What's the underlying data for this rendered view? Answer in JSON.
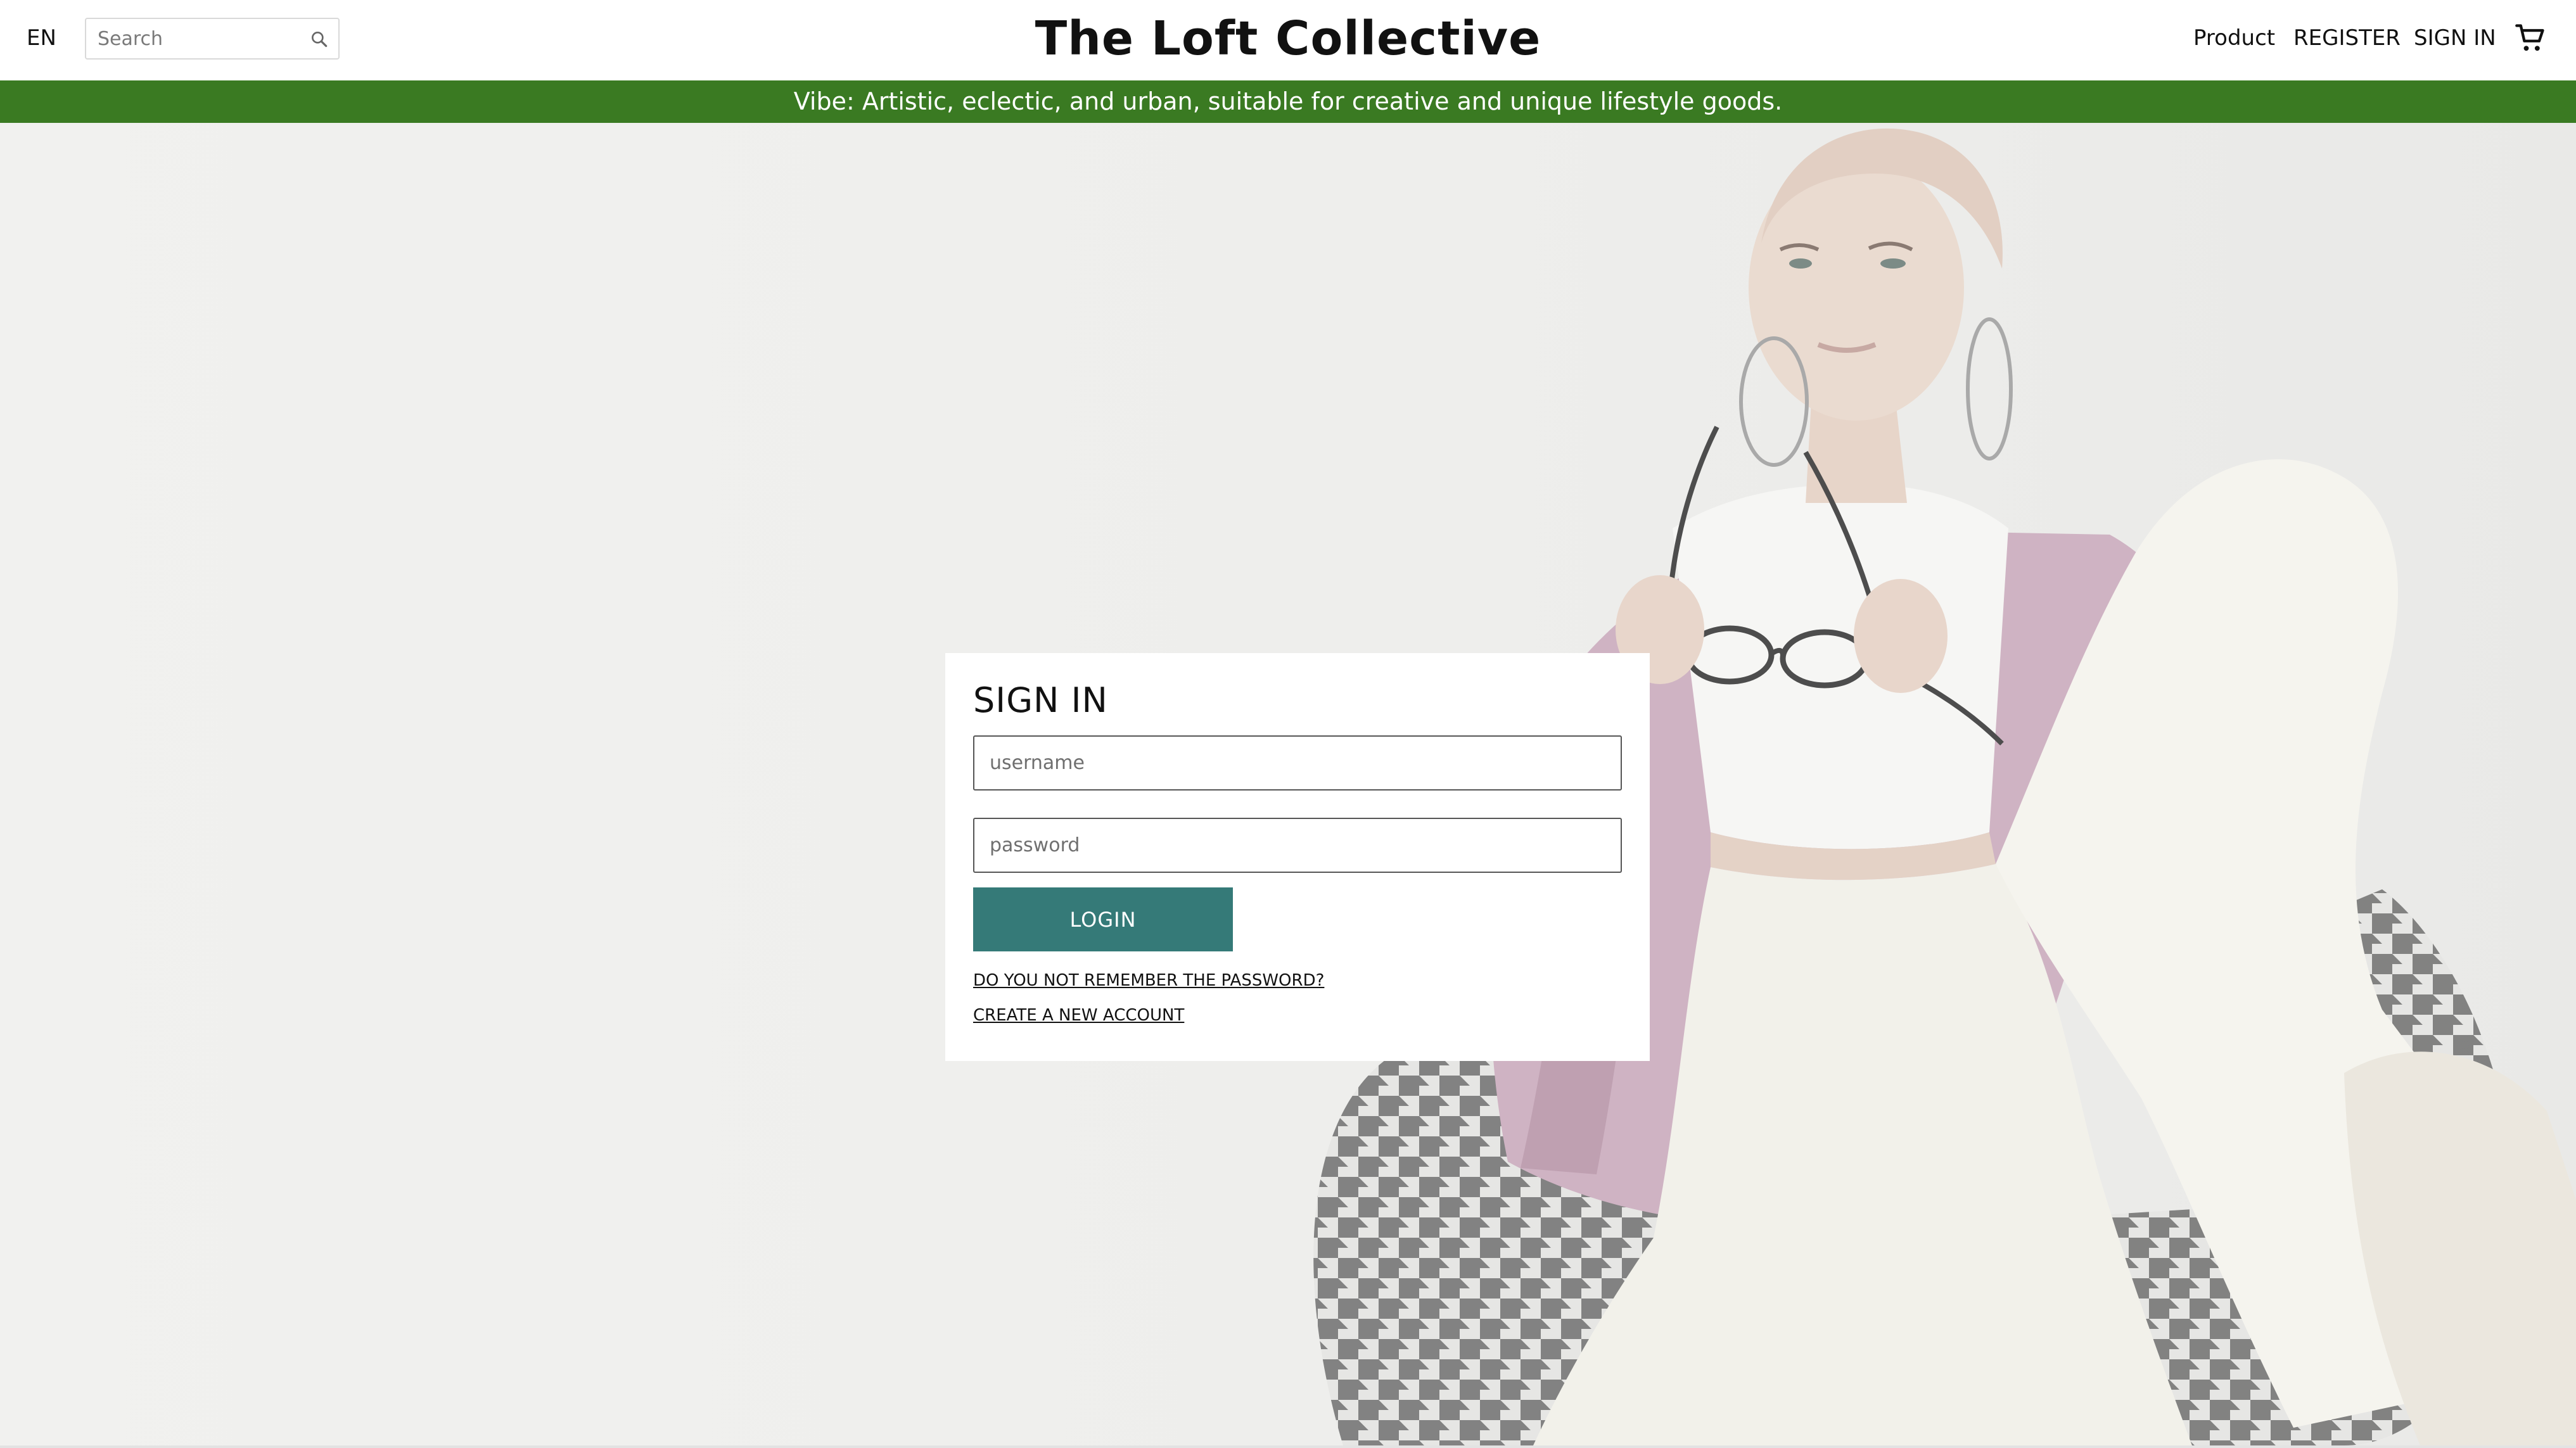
{
  "header": {
    "language": "EN",
    "search": {
      "placeholder": "Search",
      "value": "",
      "icon": "search-icon"
    },
    "site_title": "The Loft Collective",
    "nav": {
      "product": "Product",
      "register": "REGISTER",
      "sign_in": "SIGN IN"
    },
    "cart_icon": "cart-icon"
  },
  "banner": {
    "text": "Vibe: Artistic, eclectic, and urban, suitable for creative and unique lifestyle goods.",
    "color": "#3a7a22"
  },
  "signin_form": {
    "title": "SIGN IN",
    "username_placeholder": "username",
    "password_placeholder": "password",
    "login_label": "LOGIN",
    "login_color": "#357a78",
    "forgot_password": "DO YOU NOT REMEMBER THE PASSWORD?",
    "create_account": "CREATE A NEW ACCOUNT"
  }
}
